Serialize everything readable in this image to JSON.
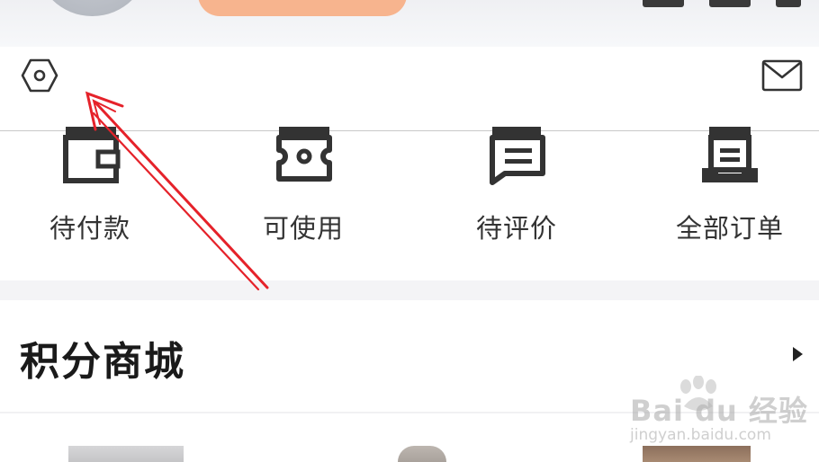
{
  "header": {
    "avatar": "user-avatar",
    "signin_pill": "signin-button"
  },
  "toolbar": {
    "settings_icon": "settings-hexagon-icon",
    "message_icon": "envelope-icon"
  },
  "orders": {
    "items": [
      {
        "label": "待付款",
        "icon": "wallet-icon"
      },
      {
        "label": "可使用",
        "icon": "ticket-icon"
      },
      {
        "label": "待评价",
        "icon": "comment-icon"
      },
      {
        "label": "全部订单",
        "icon": "order-list-icon"
      }
    ]
  },
  "mall": {
    "title": "积分商城",
    "arrow_icon": "triangle-right-icon"
  },
  "watermark": {
    "main": "Bai du 经验",
    "sub": "jingyan.baidu.com"
  },
  "colors": {
    "accent_pill": "#f7b48e",
    "annotation_red": "#e5222a",
    "text_dark": "#1a1a1a",
    "text_label": "#333333"
  }
}
